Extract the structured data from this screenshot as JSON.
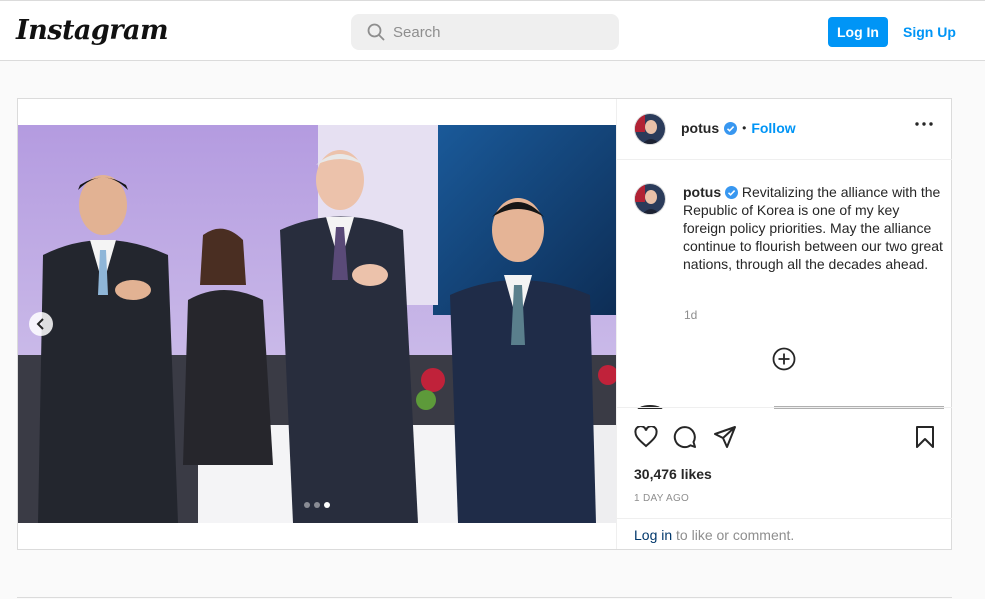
{
  "header": {
    "logo_text": "Instagram",
    "search_placeholder": "Search",
    "login_label": "Log In",
    "signup_label": "Sign Up"
  },
  "post": {
    "username": "potus",
    "follow_label": "Follow",
    "separator": "•",
    "caption": "Revitalizing the alliance with the Republic of Korea is one of my key foreign policy priorities. May the alliance continue to flourish between our two great nations, through all the decades ahead.",
    "time_ago": "1d",
    "likes": "30,476 likes",
    "date": "1 DAY AGO",
    "carousel": {
      "total": 3,
      "active_index": 2
    },
    "login_prompt": {
      "link": "Log in",
      "text": " to like or comment."
    }
  },
  "colors": {
    "accent": "#0095f6",
    "verified": "#3897f0",
    "muted": "#8e8e8e",
    "border": "#dbdbdb"
  },
  "icons": [
    "search-icon",
    "verified-badge-icon",
    "more-options-icon",
    "chevron-left-icon",
    "add-comments-icon",
    "heart-icon",
    "comment-icon",
    "share-icon",
    "bookmark-icon"
  ]
}
